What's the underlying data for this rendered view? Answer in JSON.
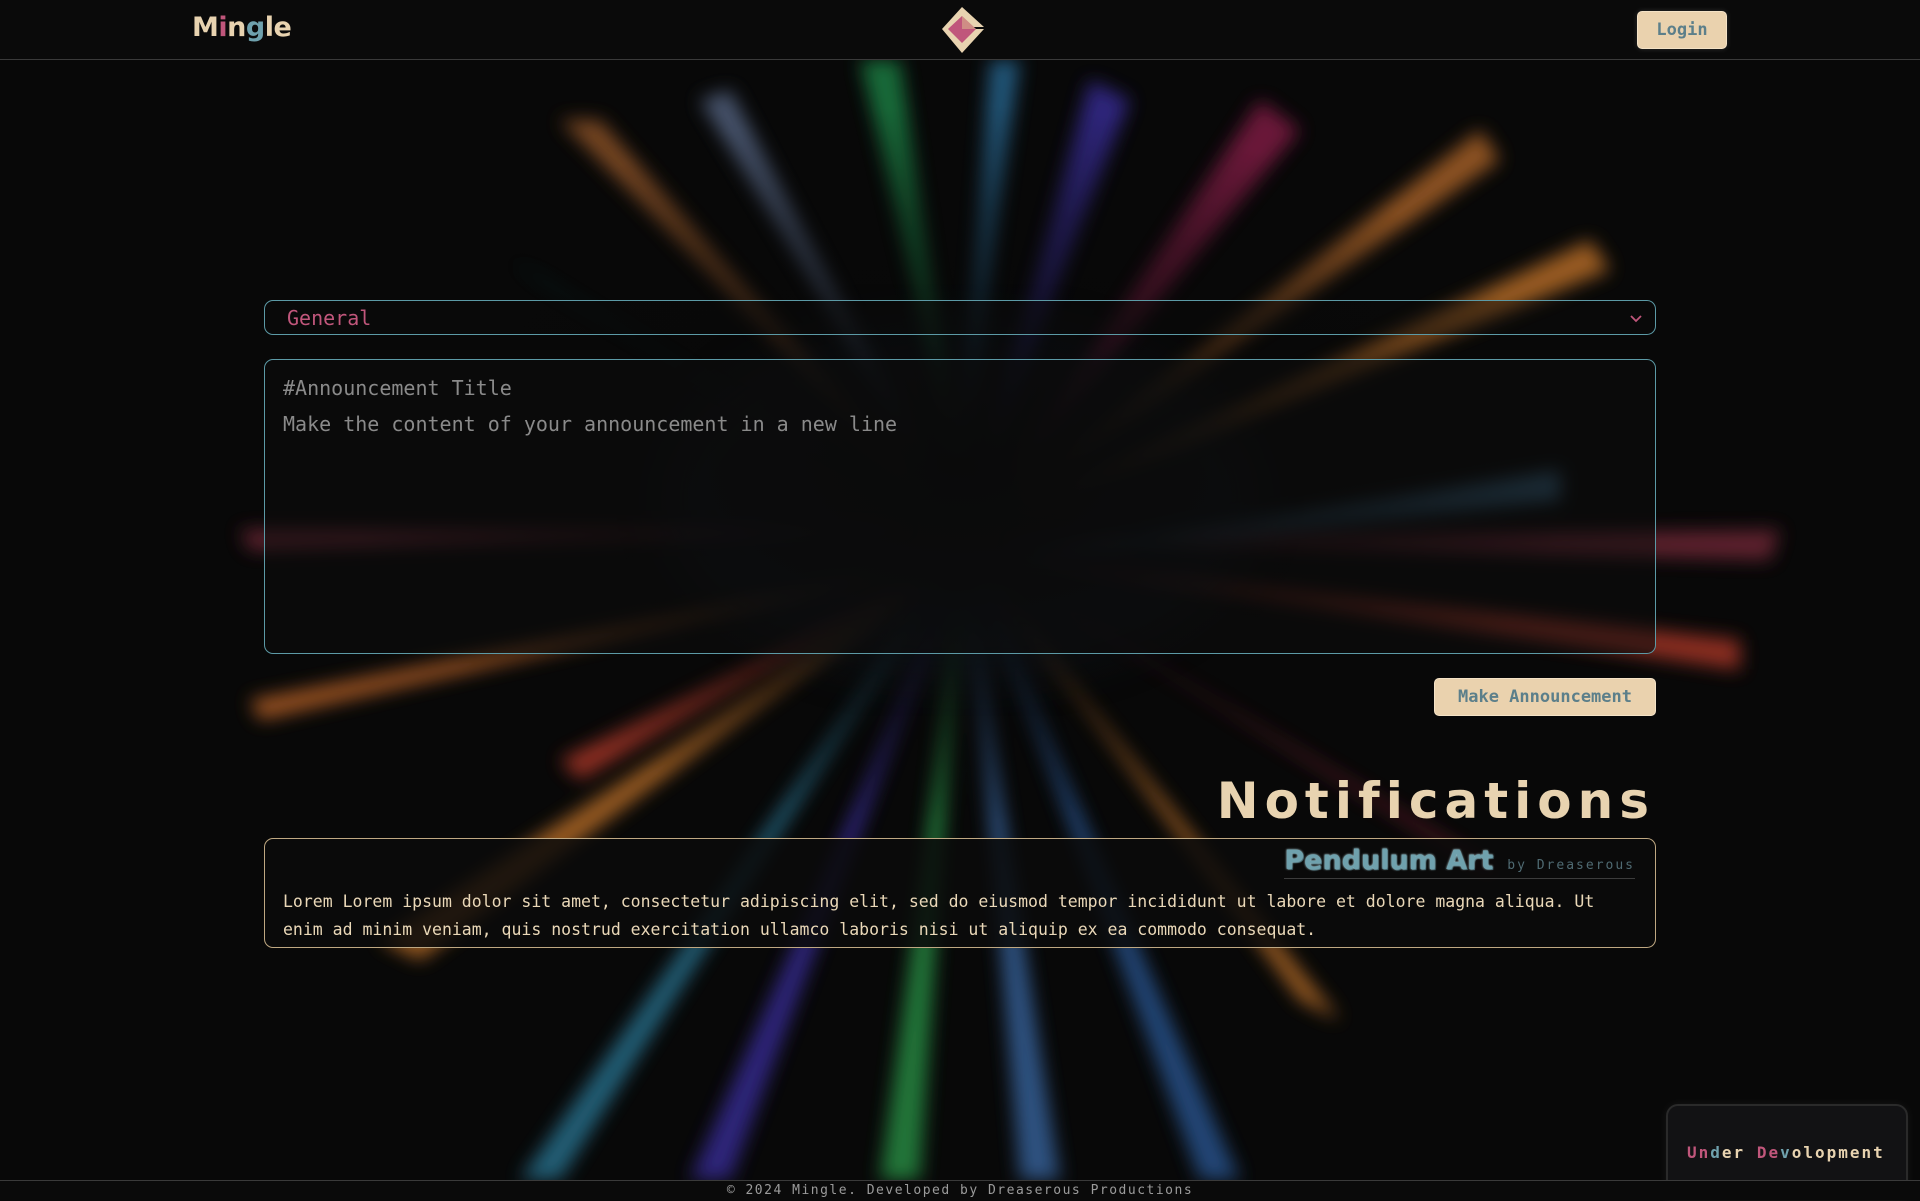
{
  "header": {
    "brand_letters": [
      "M",
      "i",
      "n",
      "g",
      "le"
    ],
    "login_label": "Login"
  },
  "composer": {
    "category_selected": "General",
    "title_placeholder": "#Announcement Title",
    "body_placeholder": "Make the content of your announcement in a new line",
    "submit_label": "Make Announcement"
  },
  "notifications": {
    "heading": "Notifications",
    "items": [
      {
        "title": "Pendulum Art",
        "author": "by Dreaserous",
        "body": "Lorem Lorem ipsum dolor sit amet, consectetur adipiscing elit, sed do eiusmod tempor incididunt ut labore et dolore magna aliqua. Ut enim ad minim veniam, quis nostrud exercitation ullamco laboris nisi ut aliquip ex ea commodo consequat."
      }
    ]
  },
  "badge": {
    "parts": [
      "Un",
      "d",
      "er ",
      "De",
      "v",
      "olopment"
    ]
  },
  "footer": {
    "text": "© 2024 Mingle. Developed by Dreaserous Productions"
  },
  "colors": {
    "cream": "#e8d3b0",
    "pink": "#c0567b",
    "teal": "#6fa1ad",
    "background": "#080808"
  }
}
